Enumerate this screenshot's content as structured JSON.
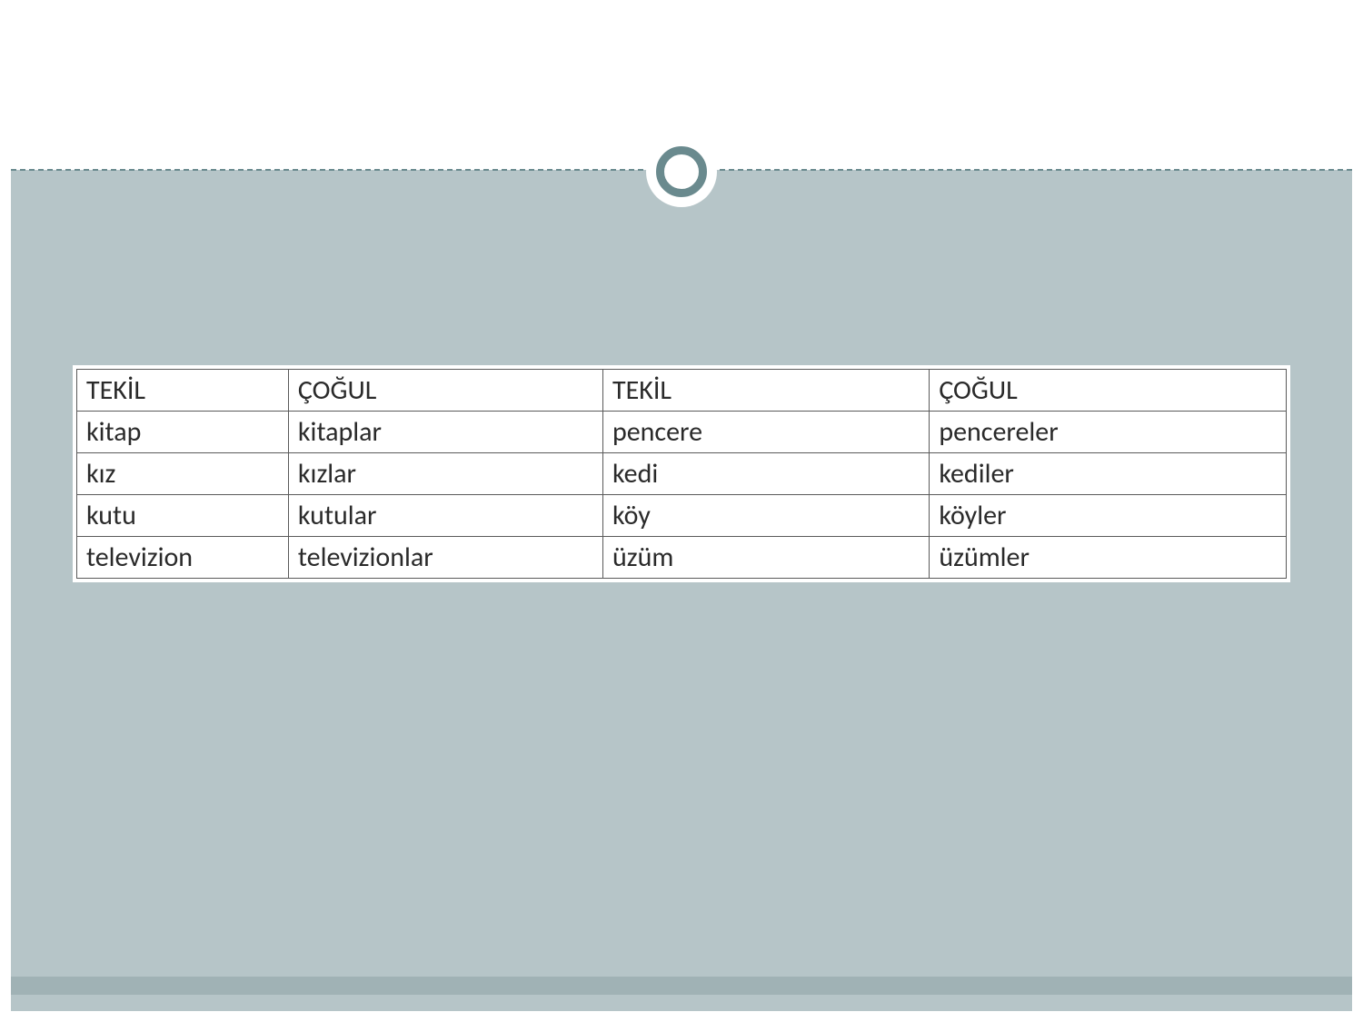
{
  "table": {
    "headers": [
      "TEKİL",
      "ÇOĞUL",
      "TEKİL",
      "ÇOĞUL"
    ],
    "rows": [
      [
        "kitap",
        "kitaplar",
        "pencere",
        "pencereler"
      ],
      [
        "kız",
        "kızlar",
        "kedi",
        "kediler"
      ],
      [
        "kutu",
        "kutular",
        "köy",
        "köyler"
      ],
      [
        "televizion",
        "televizionlar",
        "üzüm",
        "üzümler"
      ]
    ]
  }
}
